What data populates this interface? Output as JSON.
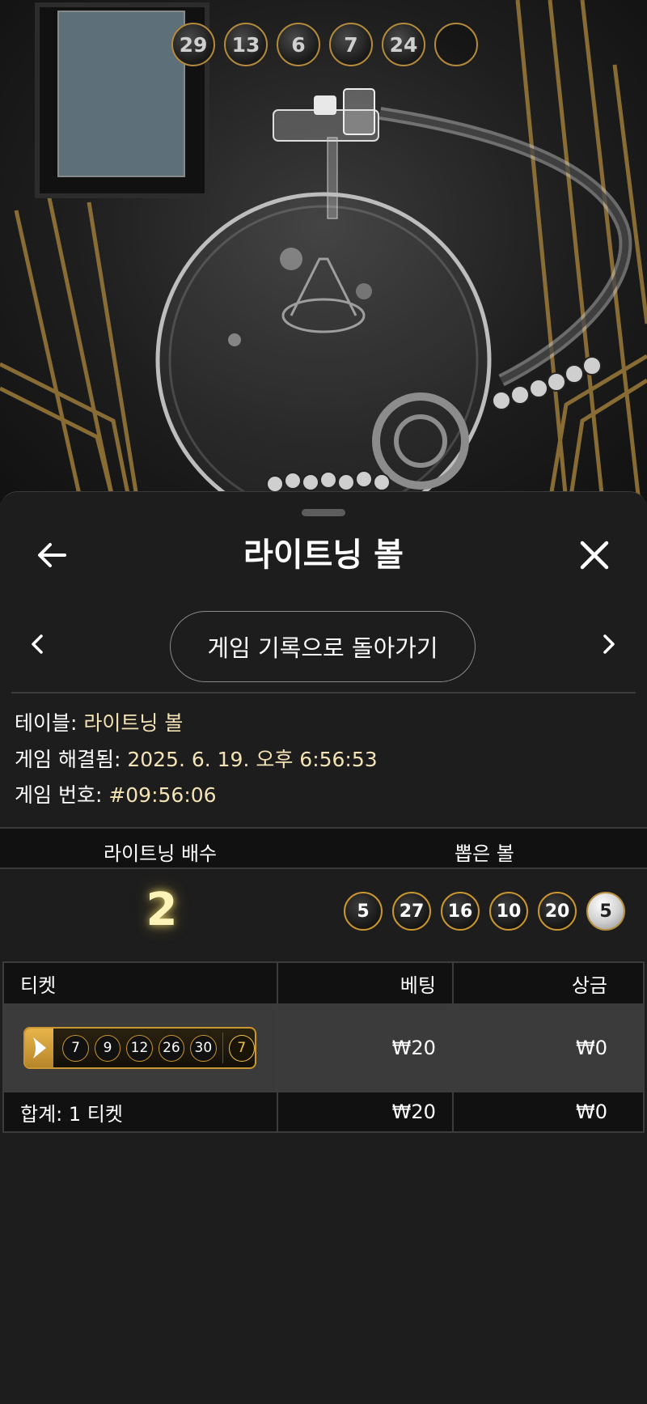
{
  "video": {
    "drawn_balls": [
      "29",
      "13",
      "6",
      "7",
      "24",
      ""
    ]
  },
  "sheet": {
    "title": "라이트닝 볼",
    "back_to_history_label": "게임 기록으로 돌아가기",
    "info": {
      "table_label": "테이블:",
      "table_value": "라이트닝 볼",
      "resolved_label": "게임 해결됨:",
      "resolved_value": "2025. 6. 19. 오후 6:56:53",
      "game_no_label": "게임 번호:",
      "game_no_value": "#09:56:06"
    },
    "result": {
      "multiplier_header": "라이트닝 배수",
      "drawn_header": "뽑은 볼",
      "multiplier_value": "2",
      "drawn_balls": [
        "5",
        "27",
        "16",
        "10",
        "20"
      ],
      "bonus_ball": "5"
    },
    "tickets": {
      "headers": {
        "ticket": "티켓",
        "bet": "베팅",
        "prize": "상금"
      },
      "rows": [
        {
          "numbers": [
            "7",
            "9",
            "12",
            "26",
            "30"
          ],
          "bonus": "7",
          "bet": "₩20",
          "prize": "₩0"
        }
      ],
      "total_label": "합계: 1 티켓",
      "total_bet": "₩20",
      "total_prize": "₩0"
    }
  },
  "colors": {
    "accent_gold": "#c9962f",
    "value_text": "#f4e3b5",
    "multiplier_glow": "#fff4b8"
  },
  "icons": [
    "arrow-left-icon",
    "close-icon",
    "chevron-left-icon",
    "chevron-right-icon",
    "lightning-icon"
  ]
}
